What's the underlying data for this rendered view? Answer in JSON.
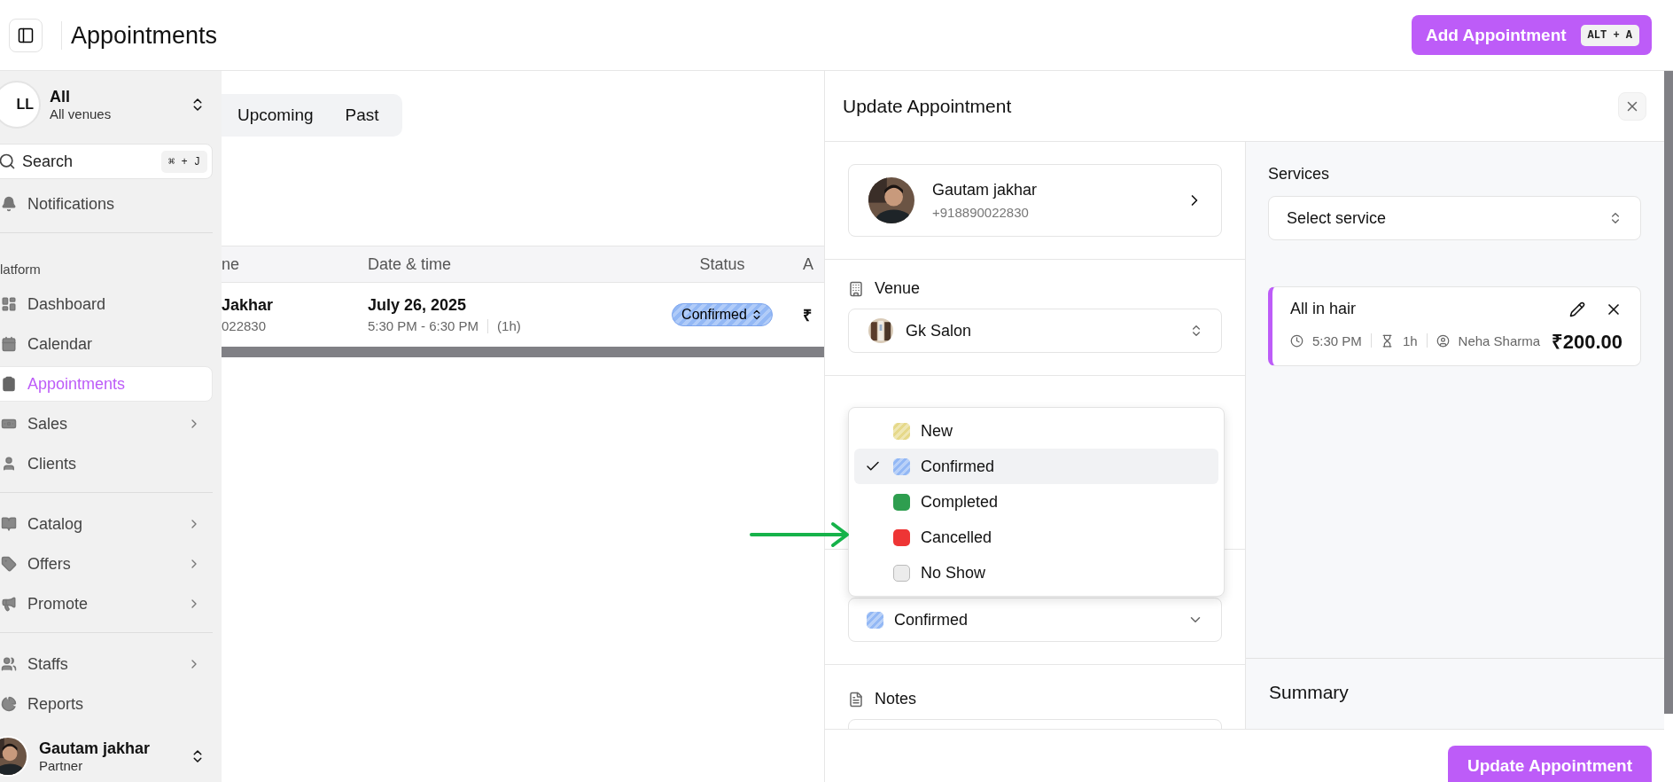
{
  "topbar": {
    "title": "Appointments",
    "add_button": {
      "label": "Add Appointment",
      "shortcut": "ALT + A"
    }
  },
  "sidebar": {
    "venue": {
      "avatar": "LL",
      "name": "All",
      "subtitle": "All venues"
    },
    "search": {
      "placeholder": "Search",
      "shortcut": "⌘ + J"
    },
    "notifications": "Notifications",
    "section": "latform",
    "groups": [
      [
        {
          "label": "Dashboard",
          "selected": false,
          "expandable": false
        },
        {
          "label": "Calendar",
          "selected": false,
          "expandable": false
        },
        {
          "label": "Appointments",
          "selected": true,
          "expandable": false
        },
        {
          "label": "Sales",
          "selected": false,
          "expandable": true
        },
        {
          "label": "Clients",
          "selected": false,
          "expandable": false
        }
      ],
      [
        {
          "label": "Catalog",
          "selected": false,
          "expandable": true
        },
        {
          "label": "Offers",
          "selected": false,
          "expandable": true
        },
        {
          "label": "Promote",
          "selected": false,
          "expandable": true
        }
      ],
      [
        {
          "label": "Staffs",
          "selected": false,
          "expandable": true
        },
        {
          "label": "Reports",
          "selected": false,
          "expandable": false
        }
      ]
    ],
    "user": {
      "name": "Gautam jakhar",
      "role": "Partner"
    }
  },
  "tabs": [
    {
      "label": "Upcoming",
      "selected": false
    },
    {
      "label": "Past",
      "selected": false
    }
  ],
  "table": {
    "columns": [
      "ne",
      "Date & time",
      "Status",
      "A"
    ],
    "rows": [
      {
        "name": "Jakhar",
        "phone": "022830",
        "date": "July 26, 2025",
        "time": "5:30 PM - 6:30 PM",
        "duration": "(1h)",
        "status": {
          "label": "Confirmed",
          "color": "#93b8f5"
        },
        "amount": "₹"
      }
    ]
  },
  "panel": {
    "title": "Update Appointment",
    "customer": {
      "name": "Gautam jakhar",
      "phone": "+918890022830"
    },
    "venue": {
      "label": "Venue",
      "value": "Gk Salon"
    },
    "status_select": {
      "value": "Confirmed",
      "color": "#93b8f5"
    },
    "status_menu": [
      {
        "label": "New",
        "color": "#e6d98a",
        "kind": "striped",
        "selected": false
      },
      {
        "label": "Confirmed",
        "color": "#93b8f5",
        "kind": "striped",
        "selected": true
      },
      {
        "label": "Completed",
        "color": "#2e9e4f",
        "kind": "solid",
        "selected": false
      },
      {
        "label": "Cancelled",
        "color": "#ee3535",
        "kind": "solid",
        "selected": false
      },
      {
        "label": "No Show",
        "color": "#ececec",
        "kind": "solid",
        "selected": false
      }
    ],
    "notes": {
      "label": "Notes"
    },
    "services": {
      "label": "Services",
      "prompt": "Select service",
      "items": [
        {
          "name": "All in hair",
          "time": "5:30 PM",
          "duration": "1h",
          "staff": "Neha Sharma",
          "price": "₹200.00"
        }
      ]
    },
    "summary": {
      "title": "Summary"
    },
    "submit": "Update Appointment"
  }
}
